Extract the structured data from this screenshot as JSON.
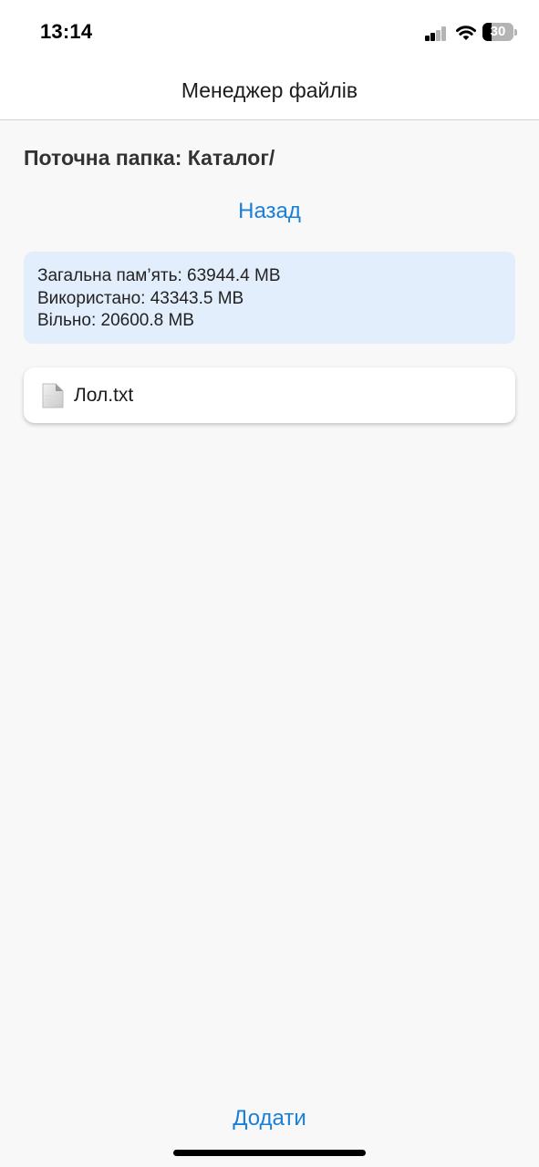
{
  "status_bar": {
    "time": "13:14",
    "battery_level": "30",
    "battery_fraction": 0.3,
    "icons": [
      "signal-icon",
      "wifi-icon",
      "battery-icon"
    ]
  },
  "header": {
    "title": "Менеджер файлів"
  },
  "folder": {
    "current_label": "Поточна папка: Каталог/"
  },
  "navigation": {
    "back_label": "Назад"
  },
  "storage": {
    "total": "Загальна пам’ять: 63944.4 MB",
    "used": "Використано: 43343.5 MB",
    "free": "Вільно: 20600.8 MB"
  },
  "files": [
    {
      "name": "Лол.txt",
      "icon": "document-icon"
    }
  ],
  "footer": {
    "add_label": "Додати"
  },
  "colors": {
    "accent": "#1a7fd6",
    "storage_card_bg": "#e3eefc",
    "page_bg": "#f8f8f8"
  }
}
